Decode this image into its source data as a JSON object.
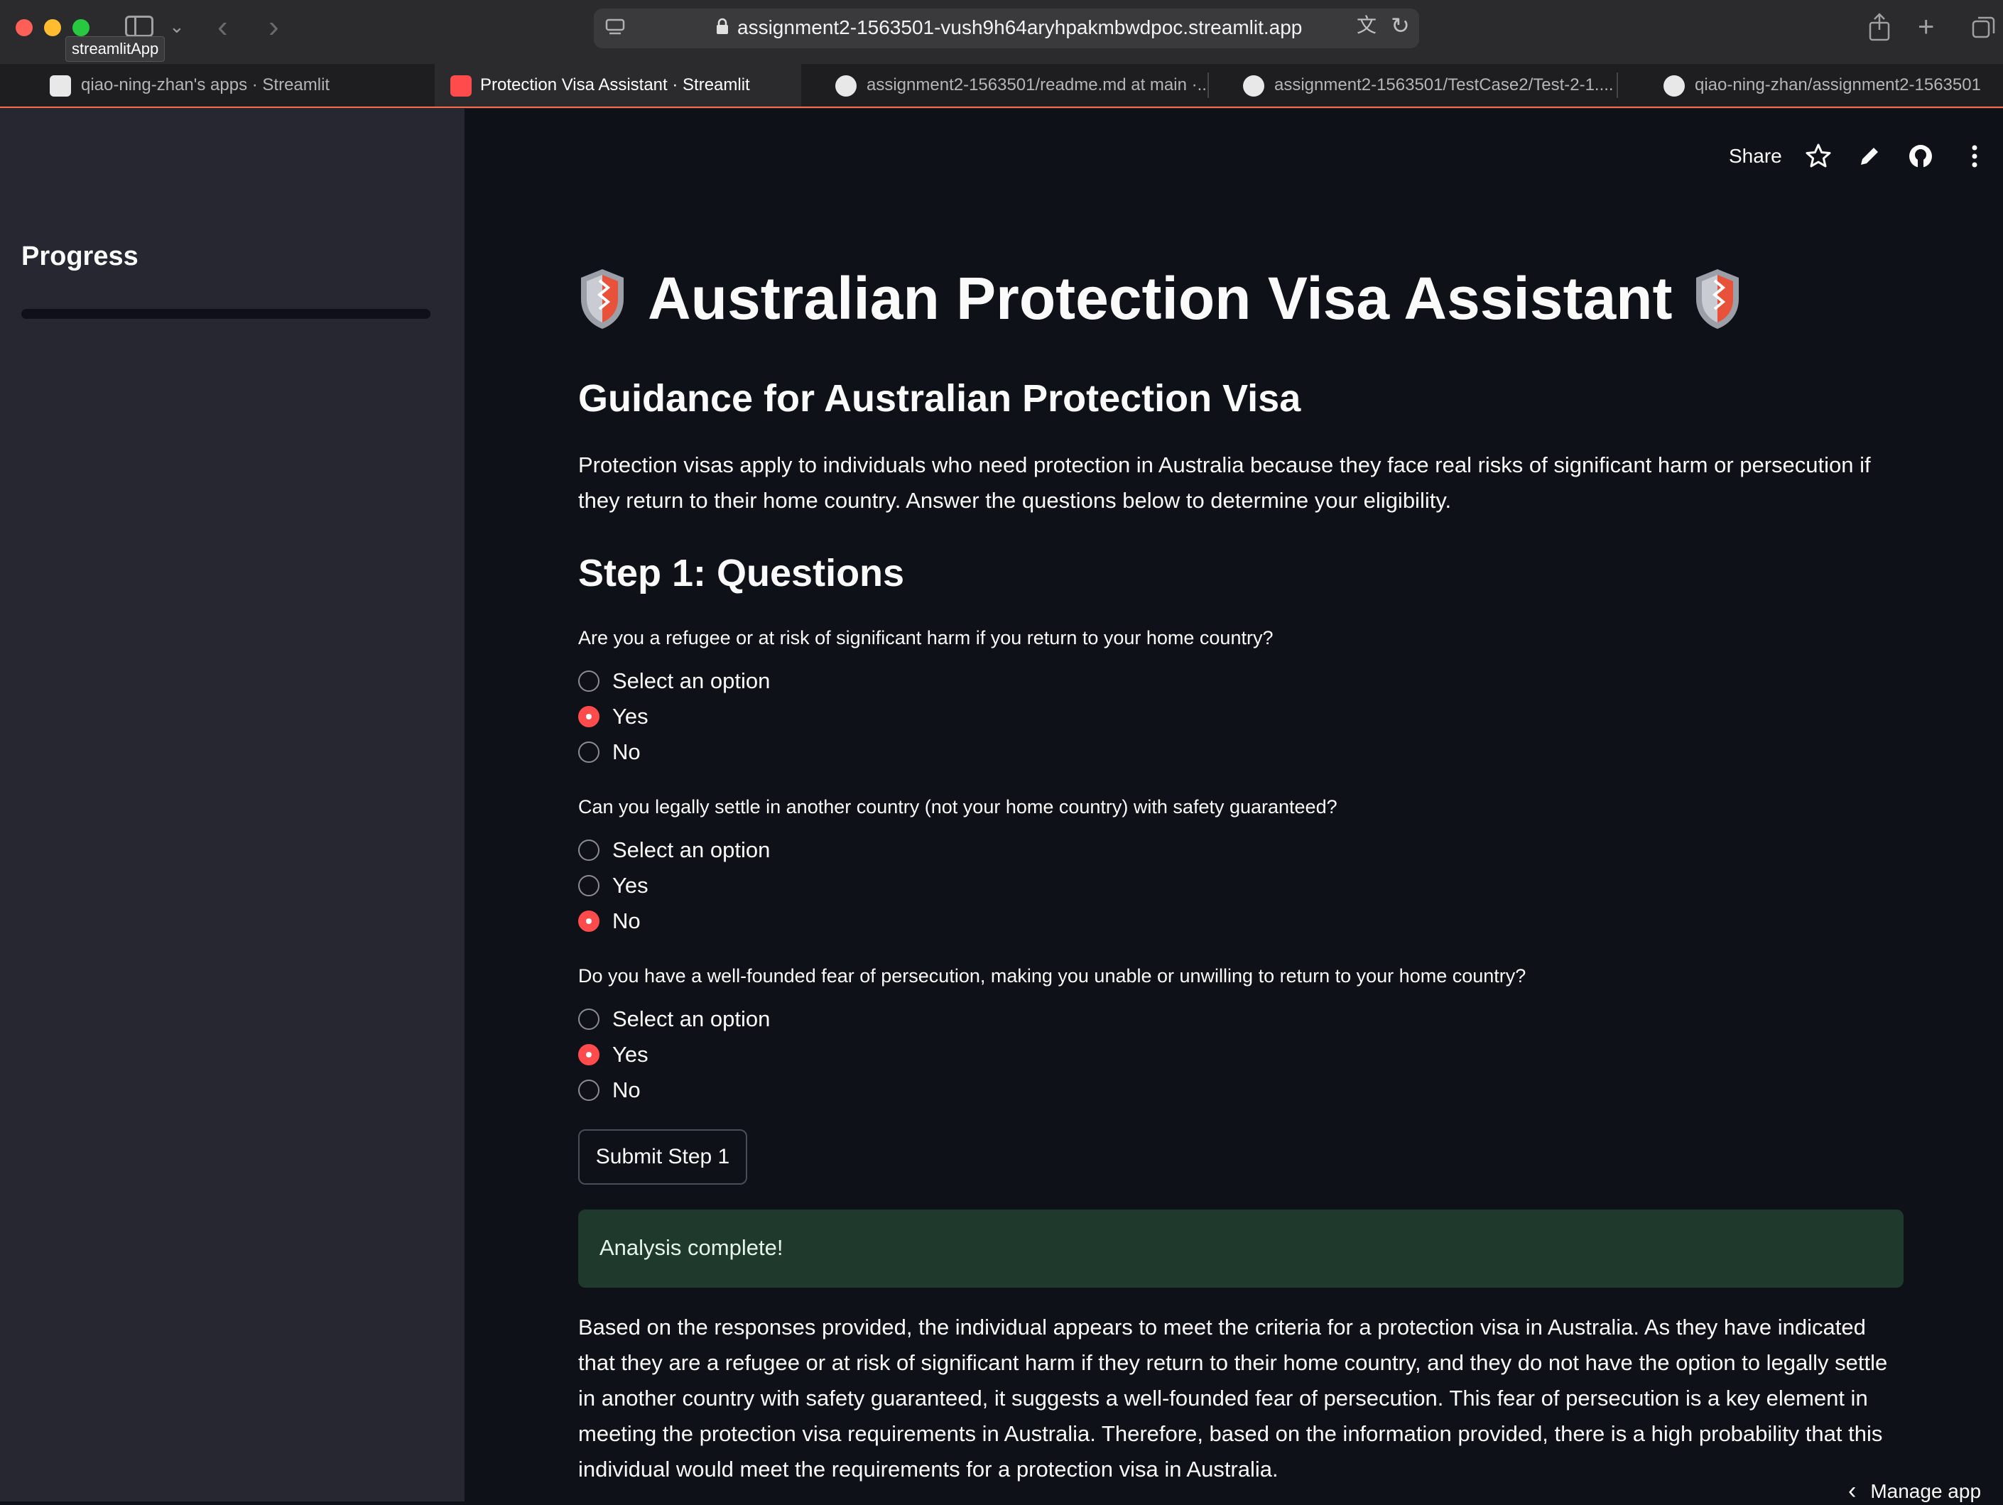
{
  "browser": {
    "tooltip": "streamlitApp",
    "url": "assignment2-1563501-vush9h64aryhpakmbwdpoc.streamlit.app",
    "tabs": [
      {
        "label": "qiao-ning-zhan's apps · Streamlit"
      },
      {
        "label": "Protection Visa Assistant · Streamlit"
      },
      {
        "label": "assignment2-1563501/readme.md at main ·..."
      },
      {
        "label": "assignment2-1563501/TestCase2/Test-2-1...."
      },
      {
        "label": "qiao-ning-zhan/assignment2-1563501"
      }
    ]
  },
  "sidebar": {
    "title": "Progress",
    "progress_fraction": 0
  },
  "toolbar": {
    "share_label": "Share"
  },
  "main": {
    "title": "Australian Protection Visa Assistant",
    "subheader": "Guidance for Australian Protection Visa",
    "intro": "Protection visas apply to individuals who need protection in Australia because they face real risks of significant harm or persecution if they return to their home country. Answer the questions below to determine your eligibility.",
    "step_title": "Step 1: Questions",
    "questions": [
      {
        "text": "Are you a refugee or at risk of significant harm if you return to your home country?",
        "options": [
          "Select an option",
          "Yes",
          "No"
        ],
        "selected": "Yes"
      },
      {
        "text": "Can you legally settle in another country (not your home country) with safety guaranteed?",
        "options": [
          "Select an option",
          "Yes",
          "No"
        ],
        "selected": "No"
      },
      {
        "text": "Do you have a well-founded fear of persecution, making you unable or unwilling to return to your home country?",
        "options": [
          "Select an option",
          "Yes",
          "No"
        ],
        "selected": "Yes"
      }
    ],
    "submit_label": "Submit Step 1",
    "success_message": "Analysis complete!",
    "analysis": "Based on the responses provided, the individual appears to meet the criteria for a protection visa in Australia. As they have indicated that they are a refugee or at risk of significant harm if they return to their home country, and they do not have the option to legally settle in another country with safety guaranteed, it suggests a well-founded fear of persecution. This fear of persecution is a key element in meeting the protection visa requirements in Australia. Therefore, based on the information provided, there is a high probability that this individual would meet the requirements for a protection visa in Australia."
  },
  "footer": {
    "manage_label": "Manage app"
  },
  "colors": {
    "accent": "#ff4b4b",
    "sidebar_bg": "#262730",
    "main_bg": "#0e1117",
    "success_bg": "#1f3a2c"
  }
}
